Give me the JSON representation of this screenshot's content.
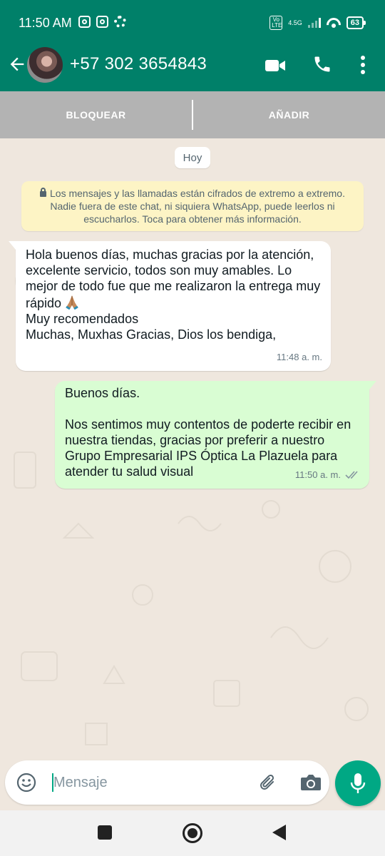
{
  "status_bar": {
    "time": "11:50 AM",
    "volte": "Vo LTE",
    "network": "4.5G",
    "battery": "63"
  },
  "header": {
    "contact": "+57 302 3654843",
    "color": "#008069"
  },
  "actions": {
    "block": "BLOQUEAR",
    "add": "AÑADIR"
  },
  "chat": {
    "date_chip": "Hoy",
    "encryption_notice": "Los mensajes y las llamadas están cifrados de extremo a extremo. Nadie fuera de este chat, ni siquiera WhatsApp, puede leerlos ni escucharlos. Toca para obtener más información.",
    "messages": [
      {
        "direction": "incoming",
        "text_main": "Hola buenos días, muchas gracias por la atención, excelente servicio, todos son muy amables. Lo mejor de todo fue que me realizaron la entrega muy rápido",
        "emoji": "folded-hands",
        "text_after": "Muy recomendados\nMuchas, Muxhas Gracias, Dios los bendiga,",
        "time": "11:48 a. m."
      },
      {
        "direction": "outgoing",
        "text": "Buenos días.\n\nNos sentimos muy contentos de poderte recibir en nuestra tiendas, gracias por preferir a nuestro Grupo Empresarial IPS Óptica La Plazuela para atender tu salud visual",
        "time": "11:50 a. m.",
        "status_icon": "double-check-icon"
      }
    ]
  },
  "composer": {
    "placeholder": "Mensaje"
  },
  "colors": {
    "accent": "#00a884",
    "incoming_bubble": "#ffffff",
    "outgoing_bubble": "#d9fdd3",
    "notice_bg": "#fdf4c5",
    "chat_bg": "#efe7de"
  }
}
